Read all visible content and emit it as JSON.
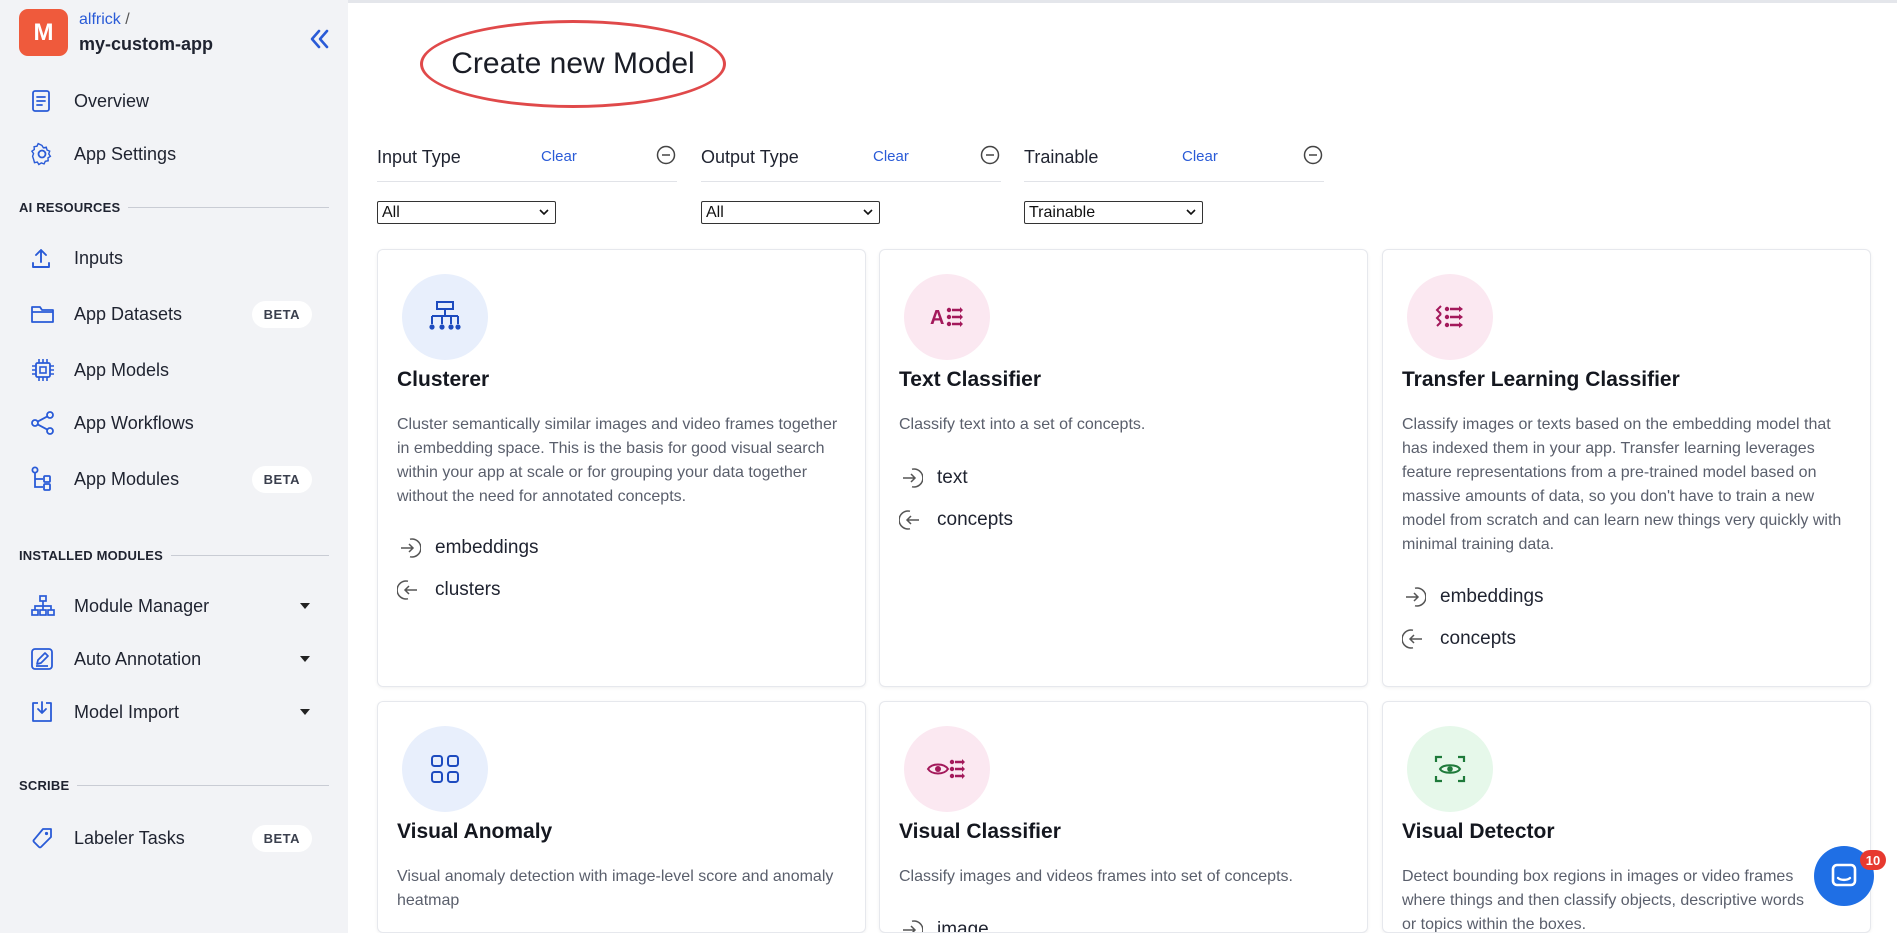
{
  "app": {
    "owner": "alfrick",
    "name": "my-custom-app",
    "avatar_letter": "M",
    "avatar_color": "#ef5a3c"
  },
  "sidebar": {
    "top_items": [
      {
        "label": "Overview",
        "icon": "document-icon"
      },
      {
        "label": "App Settings",
        "icon": "gear-icon"
      }
    ],
    "sections": [
      {
        "title": "AI RESOURCES"
      },
      {
        "title": "INSTALLED MODULES"
      },
      {
        "title": "SCRIBE"
      }
    ],
    "ai_resources": [
      {
        "label": "Inputs",
        "icon": "upload-icon"
      },
      {
        "label": "App Datasets",
        "icon": "folder-icon",
        "badge": "BETA"
      },
      {
        "label": "App Models",
        "icon": "chip-icon"
      },
      {
        "label": "App Workflows",
        "icon": "share-icon"
      },
      {
        "label": "App Modules",
        "icon": "modules-icon",
        "badge": "BETA"
      }
    ],
    "installed_modules": [
      {
        "label": "Module Manager",
        "icon": "hierarchy-icon"
      },
      {
        "label": "Auto Annotation",
        "icon": "edit-icon"
      },
      {
        "label": "Model Import",
        "icon": "import-icon"
      }
    ],
    "scribe": [
      {
        "label": "Labeler Tasks",
        "icon": "tag-icon",
        "badge": "BETA"
      }
    ]
  },
  "main": {
    "title": "Create new Model",
    "filters": [
      {
        "title": "Input Type",
        "clear": "Clear",
        "selected": "All"
      },
      {
        "title": "Output Type",
        "clear": "Clear",
        "selected": "All"
      },
      {
        "title": "Trainable",
        "clear": "Clear",
        "selected": "Trainable"
      }
    ],
    "cards": [
      {
        "title": "Clusterer",
        "icon": "cluster-icon",
        "description": "Cluster semantically similar images and video frames together in embedding space. This is the basis for good visual search within your app at scale or for grouping your data together without the need for annotated concepts.",
        "input": "embeddings",
        "output": "clusters"
      },
      {
        "title": "Text Classifier",
        "icon": "text-classifier-icon",
        "description": "Classify text into a set of concepts.",
        "input": "text",
        "output": "concepts"
      },
      {
        "title": "Transfer Learning Classifier",
        "icon": "transfer-learning-icon",
        "description": "Classify images or texts based on the embedding model that has indexed them in your app. Transfer learning leverages feature representations from a pre-trained model based on massive amounts of data, so you don't have to train a new model from scratch and can learn new things very quickly with minimal training data.",
        "input": "embeddings",
        "output": "concepts"
      },
      {
        "title": "Visual Anomaly",
        "icon": "grid-icon",
        "description": "Visual anomaly detection with image-level score and anomaly heatmap",
        "input": "",
        "output": ""
      },
      {
        "title": "Visual Classifier",
        "icon": "eye-classifier-icon",
        "description": "Classify images and videos frames into set of concepts.",
        "input": "image",
        "output": ""
      },
      {
        "title": "Visual Detector",
        "icon": "detector-icon",
        "description": "Detect bounding box regions in images or video frames where things and then classify objects, descriptive words or topics within the boxes.",
        "input": "",
        "output": ""
      }
    ]
  },
  "chat": {
    "badge_count": "10",
    "color": "#1f6fe5"
  }
}
